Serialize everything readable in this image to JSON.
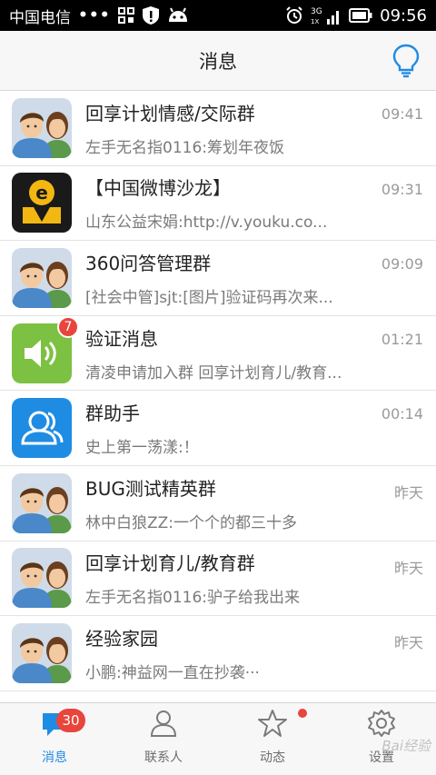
{
  "status_bar": {
    "carrier": "中国电信",
    "dots": "•••",
    "time": "09:56",
    "network": "3G"
  },
  "header": {
    "title": "消息"
  },
  "messages": [
    {
      "title": "回享计划情感/交际群",
      "subtitle": "左手无名指0116:筹划年夜饭",
      "time": "09:41",
      "avatar": "people-icon"
    },
    {
      "title": "【中国微博沙龙】",
      "subtitle": "山东公益宋娟:http://v.youku.co...",
      "time": "09:31",
      "avatar": "weibo-logo-icon"
    },
    {
      "title": "360问答管理群",
      "subtitle": "[社会中管]sjt:[图片]验证码再次来...",
      "time": "09:09",
      "avatar": "people-icon"
    },
    {
      "title": "验证消息",
      "subtitle": "清凌申请加入群 回享计划育儿/教育...",
      "time": "01:21",
      "avatar": "speaker-icon",
      "badge": "7"
    },
    {
      "title": "群助手",
      "subtitle": "史上第一荡漾:！",
      "time": "00:14",
      "avatar": "group-helper-icon"
    },
    {
      "title": "BUG测试精英群",
      "subtitle": "林中白狼ZZ:一个个的都三十多",
      "time": "昨天",
      "avatar": "people-icon"
    },
    {
      "title": "回享计划育儿/教育群",
      "subtitle": "左手无名指0116:驴子给我出来",
      "time": "昨天",
      "avatar": "people-icon"
    },
    {
      "title": "经验家园",
      "subtitle": "小鹏:神益网一直在抄袭···",
      "time": "昨天",
      "avatar": "people-icon"
    }
  ],
  "tabs": [
    {
      "label": "消息",
      "icon": "chat-bubble-icon",
      "badge": "30",
      "active": true
    },
    {
      "label": "联系人",
      "icon": "person-icon"
    },
    {
      "label": "动态",
      "icon": "star-icon",
      "dot": true
    },
    {
      "label": "设置",
      "icon": "gear-icon"
    }
  ],
  "watermark": "Bai经验",
  "colors": {
    "accent": "#1f8ce3",
    "badge": "#e8453c",
    "speaker_green": "#7cc142"
  }
}
